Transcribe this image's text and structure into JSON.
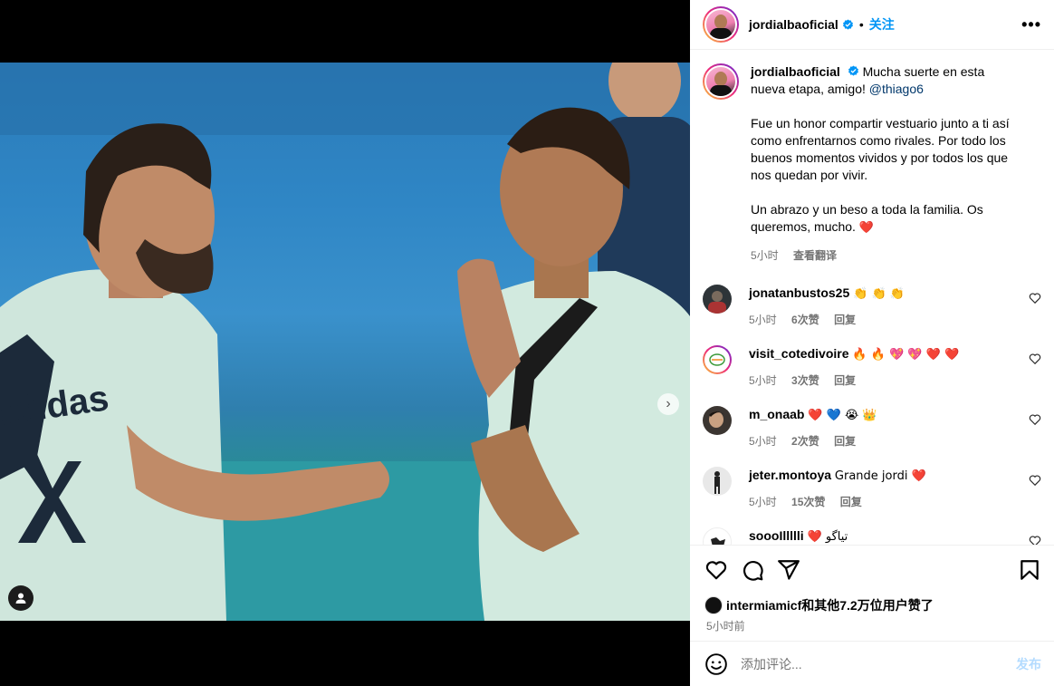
{
  "post": {
    "username": "jordialbaoficial",
    "separator": "•",
    "follow_label": "关注",
    "more_icon": "more-horizontal-icon"
  },
  "caption": {
    "username": "jordialbaoficial",
    "line1": "Mucha suerte en esta nueva etapa, amigo! ",
    "mention": "@thiago6",
    "para2": "Fue un honor compartir vestuario junto a ti así como enfrentarnos como rivales. Por todo los buenos momentos vividos y por todos los que nos quedan por vivir.",
    "para3": "Un abrazo y un beso a toda la familia. Os queremos, mucho. ",
    "para3_emoji": "❤️",
    "time": "5小时",
    "translate": "查看翻译"
  },
  "comments": [
    {
      "username": "jonatanbustos25",
      "text": "👏 👏 👏",
      "time": "5小时",
      "likes": "6次赞",
      "reply": "回复"
    },
    {
      "username": "visit_cotedivoire",
      "text": "🔥 🔥 💖 💖 ❤️ ❤️",
      "time": "5小时",
      "likes": "3次赞",
      "reply": "回复"
    },
    {
      "username": "m_onaab",
      "text": "❤️ 💙 😭 👑",
      "time": "5小时",
      "likes": "2次赞",
      "reply": "回复"
    },
    {
      "username": "jeter.montoya",
      "text": "Grande jordi ❤️",
      "time": "5小时",
      "likes": "15次赞",
      "reply": "回复"
    },
    {
      "username": "soooIllllli",
      "text": "❤️ تياگو",
      "time": "",
      "likes": "",
      "reply": ""
    }
  ],
  "likes": {
    "summary": "intermiamicf和其他7.2万位用户赞了",
    "time": "5小时前"
  },
  "add_comment": {
    "placeholder": "添加评论...",
    "post_label": "发布"
  },
  "carousel": {
    "total": 3,
    "active": 0,
    "next_glyph": "›"
  },
  "colors": {
    "accent": "#0095f6",
    "verified": "#0095f6",
    "mention": "#00376b",
    "secondary_text": "#737373",
    "heart_red": "#ed4956"
  }
}
